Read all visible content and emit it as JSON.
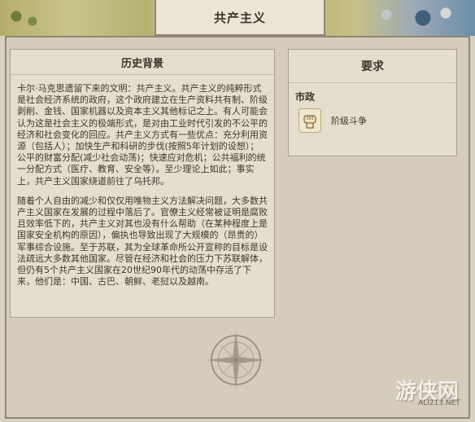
{
  "header": {
    "title": "共产主义"
  },
  "history": {
    "heading": "历史背景",
    "paragraphs": [
      "卡尔·马克思遗留下来的文明：共产主义。共产主义的纯粹形式是社会经济系统的政府，这个政府建立在生产资料共有制、阶级剥削、金钱、国家机器以及资本主义其他标记之上。有人可能会认为这是社会主义的极端形式，是对由工业时代引发的不公平的经济和社会变化的回应。共产主义方式有一些优点：充分利用资源（包括人）；加快生产和科研的步伐(按照5年计划的设想）；公平的财富分配(减少社会动荡)；快速应对危机；公共福利的统一分配方式（医疗、教育、安全等）。至少理论上如此；事实上，共产主义国家绕道前往了乌托邦。",
      "随着个人自由的减少和仅仅用唯物主义方法解决问题，大多数共产主义国家在发展的过程中落后了。官僚主义经常被证明是腐败且效率低下的，共产主义对其也没有什么帮助（在某种程度上是国家安全机构的原因），偏执也导致出现了大规模的（昂贵的）军事综合设施。至于苏联，其为全球革命所公开宣称的目标是设法疏远大多数其他国家。尽管在经济和社会的压力下苏联解体，但仍有5个共产主义国家在20世纪90年代的动荡中存活了下来，他们是：中国、古巴、朝鲜、老挝以及越南。"
    ]
  },
  "requirements": {
    "heading": "要求",
    "section": "市政",
    "items": [
      {
        "label": "阶级斗争",
        "icon": "fist-icon"
      }
    ]
  },
  "watermark": {
    "text": "游侠网",
    "sub": "ALI213.NET"
  },
  "colors": {
    "panel": "#e5dece",
    "frame": "#d5ccbb",
    "border": "#8f8676"
  }
}
